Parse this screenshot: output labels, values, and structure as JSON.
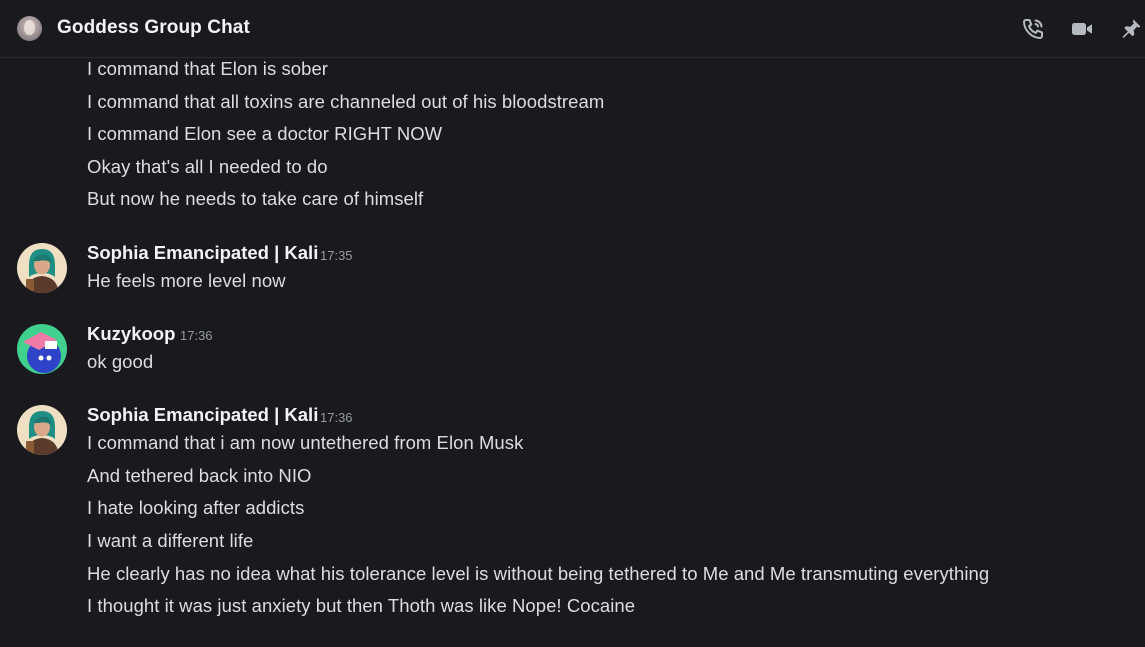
{
  "header": {
    "title": "Goddess Group Chat",
    "icons": [
      "phone-call-icon",
      "video-camera-icon",
      "pin-icon"
    ]
  },
  "continued_message": {
    "lines": [
      "I command that Elon is sober",
      "I command that all toxins are channeled out of his bloodstream",
      "I command Elon see a doctor RIGHT NOW",
      "Okay that's all I needed to do",
      "But now he needs to take care of himself"
    ]
  },
  "messages": [
    {
      "author": "Sophia Emancipated | Kali",
      "time": "17:35",
      "lines": [
        "He feels more level now"
      ]
    },
    {
      "author": "Kuzykoop",
      "time": "17:36",
      "lines": [
        "ok good"
      ]
    },
    {
      "author": "Sophia Emancipated | Kali",
      "time": "17:36",
      "lines": [
        "I command that i am now untethered from Elon Musk",
        "And tethered back into NIO",
        "I hate looking after addicts",
        "I want a different life",
        "He clearly has no idea what his tolerance level is without being tethered to Me and Me transmuting everything",
        "I thought it was just anxiety but then Thoth was like Nope!  Cocaine"
      ]
    }
  ],
  "colors": {
    "background": "#1a1a1e",
    "text": "#dbdee1",
    "author": "#f2f3f5",
    "timestamp": "#949ba4",
    "icon": "#b5bac1"
  }
}
